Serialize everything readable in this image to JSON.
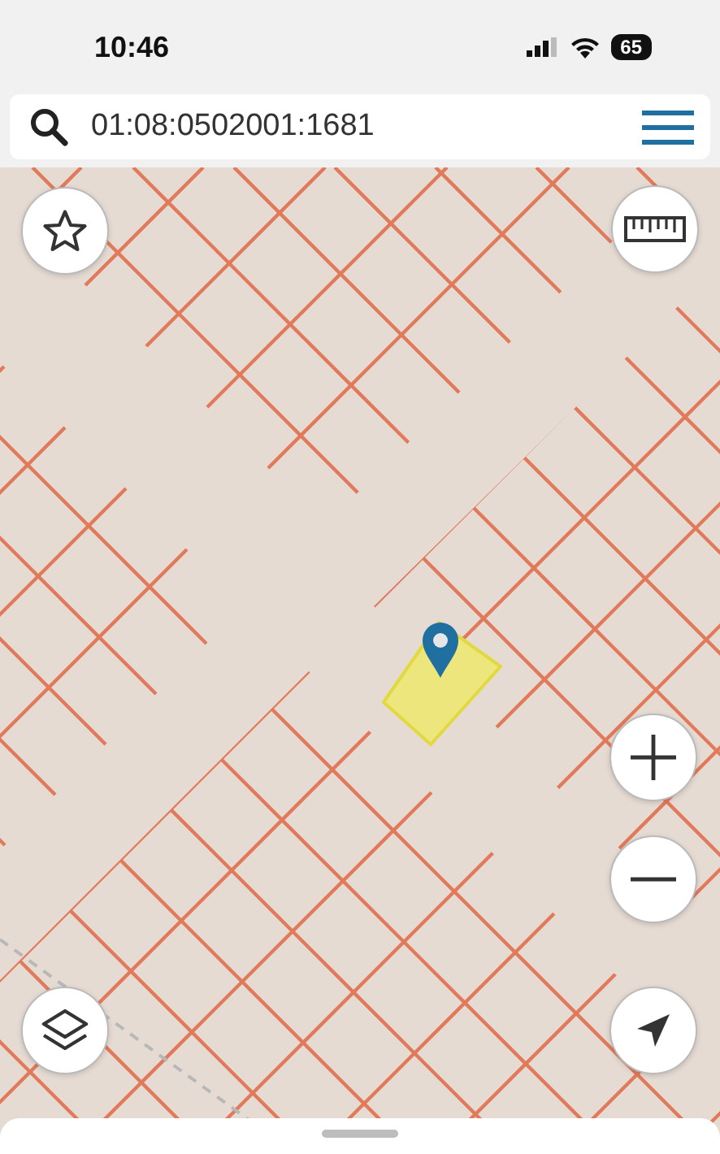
{
  "status_bar": {
    "time": "10:46",
    "battery": "65"
  },
  "search": {
    "value": "01:08:0502001:1681"
  }
}
